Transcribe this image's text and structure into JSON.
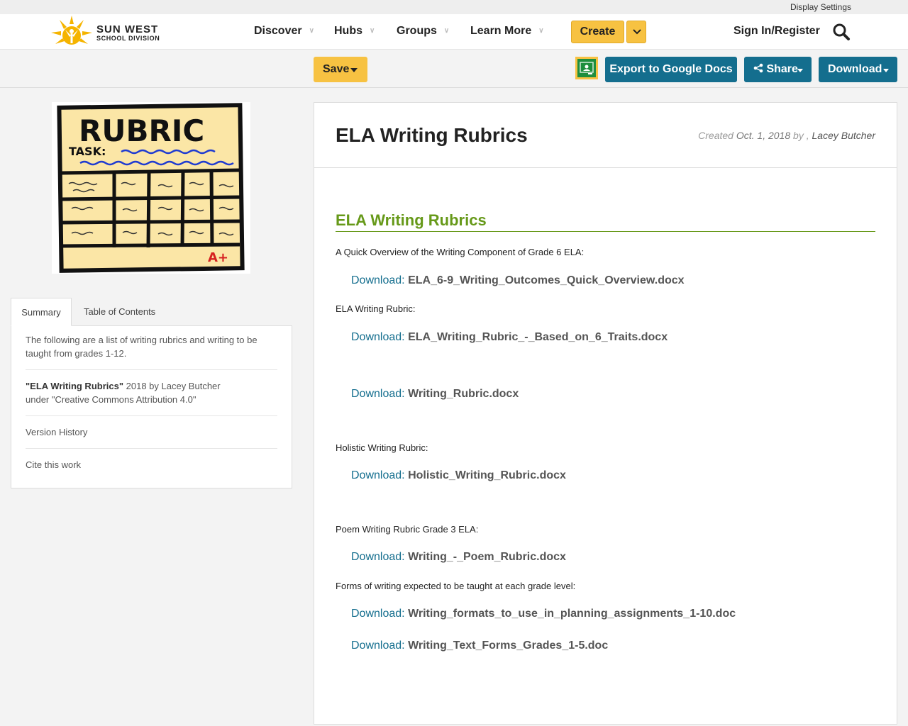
{
  "utility": {
    "display_settings": "Display Settings"
  },
  "brand": {
    "title": "SUN WEST",
    "subtitle": "SCHOOL DIVISION"
  },
  "nav": {
    "items": [
      {
        "label": "Discover"
      },
      {
        "label": "Hubs"
      },
      {
        "label": "Groups"
      },
      {
        "label": "Learn More"
      }
    ],
    "create_label": "Create",
    "signin_label": "Sign In/Register"
  },
  "actions": {
    "save_label": "Save",
    "export_label": "Export to Google Docs",
    "share_label": "Share",
    "download_label": "Download"
  },
  "sidebar": {
    "cover_text": {
      "title": "RUBRIC",
      "task": "TASK:",
      "grade": "A+"
    },
    "tabs": [
      {
        "label": "Summary",
        "active": true
      },
      {
        "label": "Table of Contents",
        "active": false
      }
    ],
    "summary": "The following are a list of writing rubrics and writing to be taught from grades 1-12.",
    "attribution": {
      "title": "\"ELA Writing Rubrics\"",
      "year_by": "2018 by Lacey Butcher",
      "license": "under \"Creative Commons Attribution 4.0\""
    },
    "version_history": "Version History",
    "cite": "Cite this work"
  },
  "content": {
    "title": "ELA Writing Rubrics",
    "created_label": "Created",
    "created_date": "Oct. 1, 2018",
    "created_by": "by ,",
    "author": "Lacey Butcher",
    "section_heading": "ELA Writing Rubrics",
    "paragraphs": [
      "A Quick Overview of the Writing Component of Grade 6 ELA:",
      "ELA Writing Rubric:",
      "Holistic Writing Rubric:",
      "Poem Writing Rubric Grade 3 ELA:",
      "Forms of writing expected to be taught at each grade level:"
    ],
    "download_prefix": "Download:",
    "downloads": [
      "ELA_6-9_Writing_Outcomes_Quick_Overview.docx",
      "ELA_Writing_Rubric_-_Based_on_6_Traits.docx",
      "Writing_Rubric.docx",
      "Holistic_Writing_Rubric.docx",
      "Writing_-_Poem_Rubric.docx",
      "Writing_formats_to_use_in_planning_assignments_1-10.doc",
      "Writing_Text_Forms_Grades_1-5.doc"
    ]
  },
  "colors": {
    "accent_yellow": "#f7c242",
    "primary_blue": "#146e8e",
    "heading_green": "#669919"
  }
}
